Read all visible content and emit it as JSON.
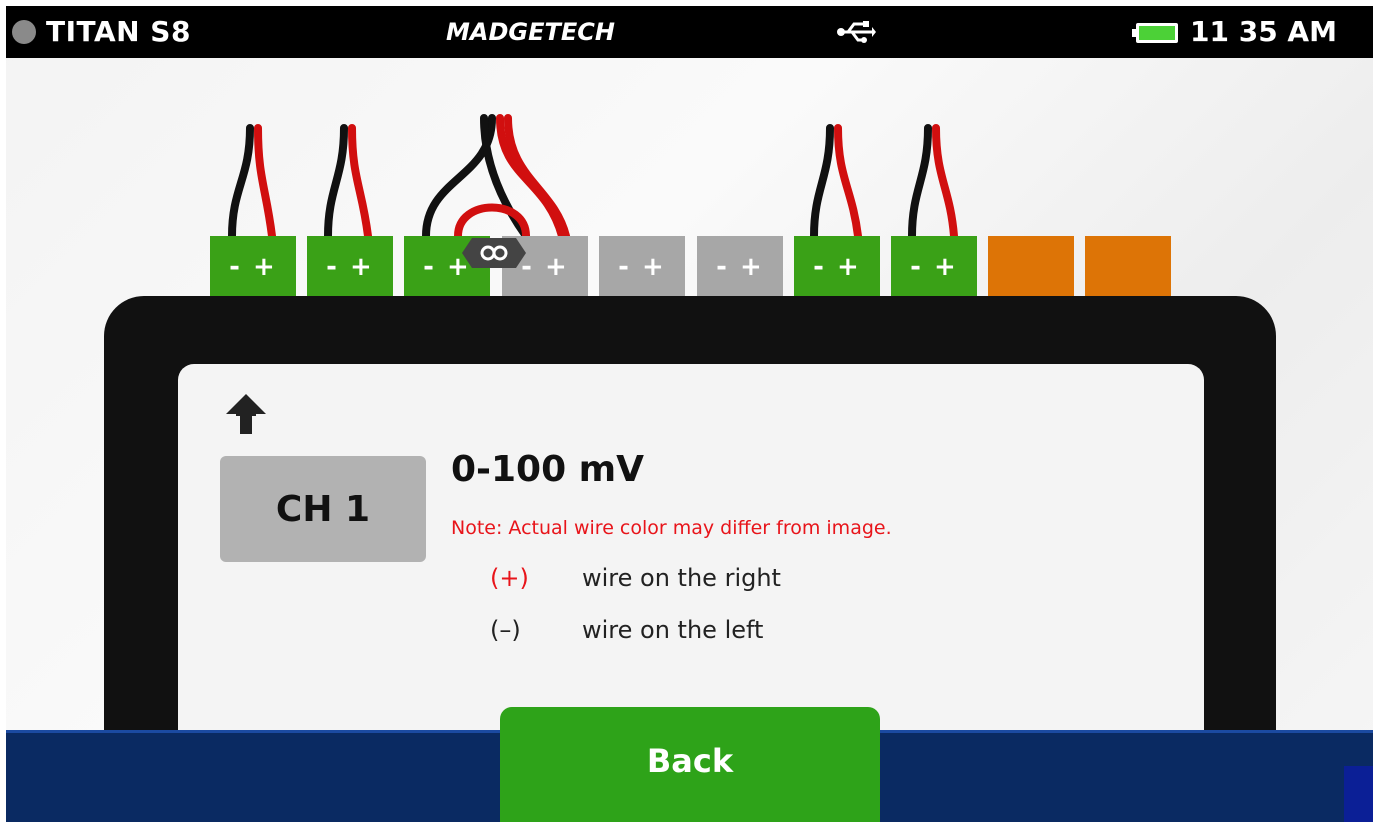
{
  "status_bar": {
    "device_name": "TITAN S8",
    "brand": "MADGETECH",
    "time": "11 35 AM",
    "battery_color": "#4cd137",
    "icons": [
      "status-dot-icon",
      "usb-icon",
      "battery-icon"
    ]
  },
  "terminals": [
    {
      "label": "- +",
      "color": "green"
    },
    {
      "label": "- +",
      "color": "green"
    },
    {
      "label": "- +",
      "color": "green"
    },
    {
      "label": "- +",
      "color": "gray"
    },
    {
      "label": "- +",
      "color": "gray"
    },
    {
      "label": "- +",
      "color": "gray"
    },
    {
      "label": "- +",
      "color": "green"
    },
    {
      "label": "- +",
      "color": "green"
    },
    {
      "label": "",
      "color": "orange"
    },
    {
      "label": "",
      "color": "orange"
    }
  ],
  "panel": {
    "channel": "CH 1",
    "range": "0-100 mV",
    "note": "Note: Actual wire color may differ from image.",
    "wires": [
      {
        "symbol": "(+)",
        "text": "wire on the right"
      },
      {
        "symbol": "(–)",
        "text": "wire on the left"
      }
    ]
  },
  "footer": {
    "back_label": "Back"
  },
  "colors": {
    "green_terminal": "#3aa117",
    "gray_terminal": "#a7a7a7",
    "orange_terminal": "#dd7406",
    "note_red": "#e8141a",
    "footer_blue": "#0a2a62",
    "button_green": "#2ea319"
  }
}
